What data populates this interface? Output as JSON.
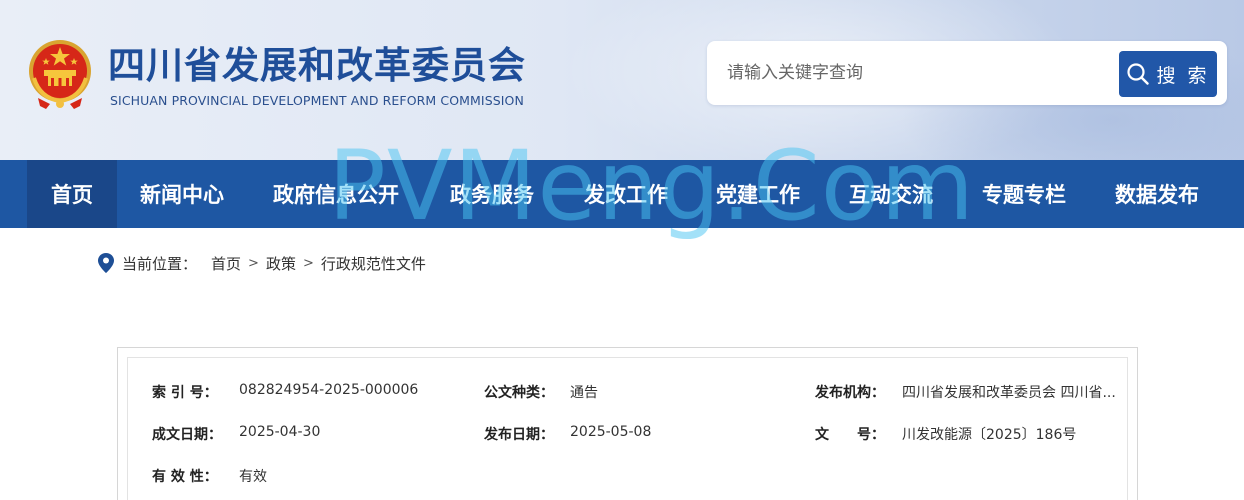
{
  "header": {
    "title": "四川省发展和改革委员会",
    "subtitle": "SICHUAN PROVINCIAL DEVELOPMENT AND REFORM COMMISSION",
    "emblem_icon": "national-emblem-icon"
  },
  "search": {
    "placeholder": "请输入关键字查询",
    "button_label": "搜 索"
  },
  "nav": {
    "items": [
      {
        "label": "首页",
        "active": true
      },
      {
        "label": "新闻中心"
      },
      {
        "label": "政府信息公开"
      },
      {
        "label": "政务服务"
      },
      {
        "label": "发改工作"
      },
      {
        "label": "党建工作"
      },
      {
        "label": "互动交流"
      },
      {
        "label": "专题专栏"
      },
      {
        "label": "数据发布"
      }
    ]
  },
  "watermark": "PVMeng.Com",
  "breadcrumb": {
    "label": "当前位置：",
    "items": [
      "首页",
      "政策",
      "行政规范性文件"
    ],
    "separator": ">"
  },
  "doc_info": {
    "index_no": {
      "label": "索 引 号：",
      "value": "082824954-2025-000006"
    },
    "doc_type": {
      "label": "公文种类：",
      "value": "通告"
    },
    "publisher": {
      "label": "发布机构：",
      "value": "四川省发展和改革委员会 四川省..."
    },
    "written_date": {
      "label": "成文日期：",
      "value": "2025-04-30"
    },
    "publish_date": {
      "label": "发布日期：",
      "value": "2025-05-08"
    },
    "doc_no": {
      "label": "文　　号：",
      "value": "川发改能源〔2025〕186号"
    },
    "validity": {
      "label": "有 效 性：",
      "value": "有效"
    }
  },
  "colors": {
    "brand_blue": "#1e57a3",
    "nav_active": "#1a4789",
    "search_button": "#2157a8",
    "title_blue": "#1f4e99"
  }
}
